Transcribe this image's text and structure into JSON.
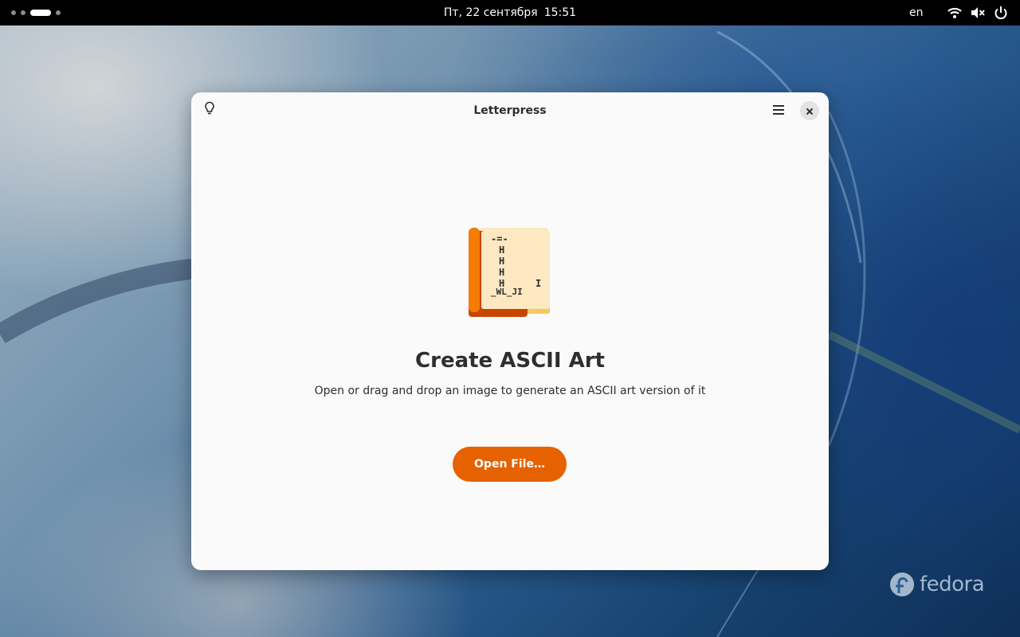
{
  "topbar": {
    "clock_date": "Пт, 22 сентября",
    "clock_time": "15:51",
    "keyboard_layout": "en",
    "icons": [
      "wifi-icon",
      "volume-muted-icon",
      "power-icon"
    ]
  },
  "window": {
    "title": "Letterpress",
    "tips_icon": "lightbulb-icon",
    "menu_icon": "hamburger-menu-icon",
    "close_icon": "close-icon",
    "app_icon_ascii": {
      "top": "-=-",
      "rows": [
        "H",
        "H",
        "H",
        "H"
      ],
      "bottom": "_WL_JI",
      "side": "I"
    },
    "heading": "Create ASCII Art",
    "description": "Open or drag and drop an image to generate an ASCII art version of it",
    "open_button_label": "Open File…"
  },
  "desktop": {
    "logo_text": "fedora"
  },
  "colors": {
    "accent": "#e66100",
    "window_bg": "#fafafa",
    "topbar_bg": "#000000"
  }
}
